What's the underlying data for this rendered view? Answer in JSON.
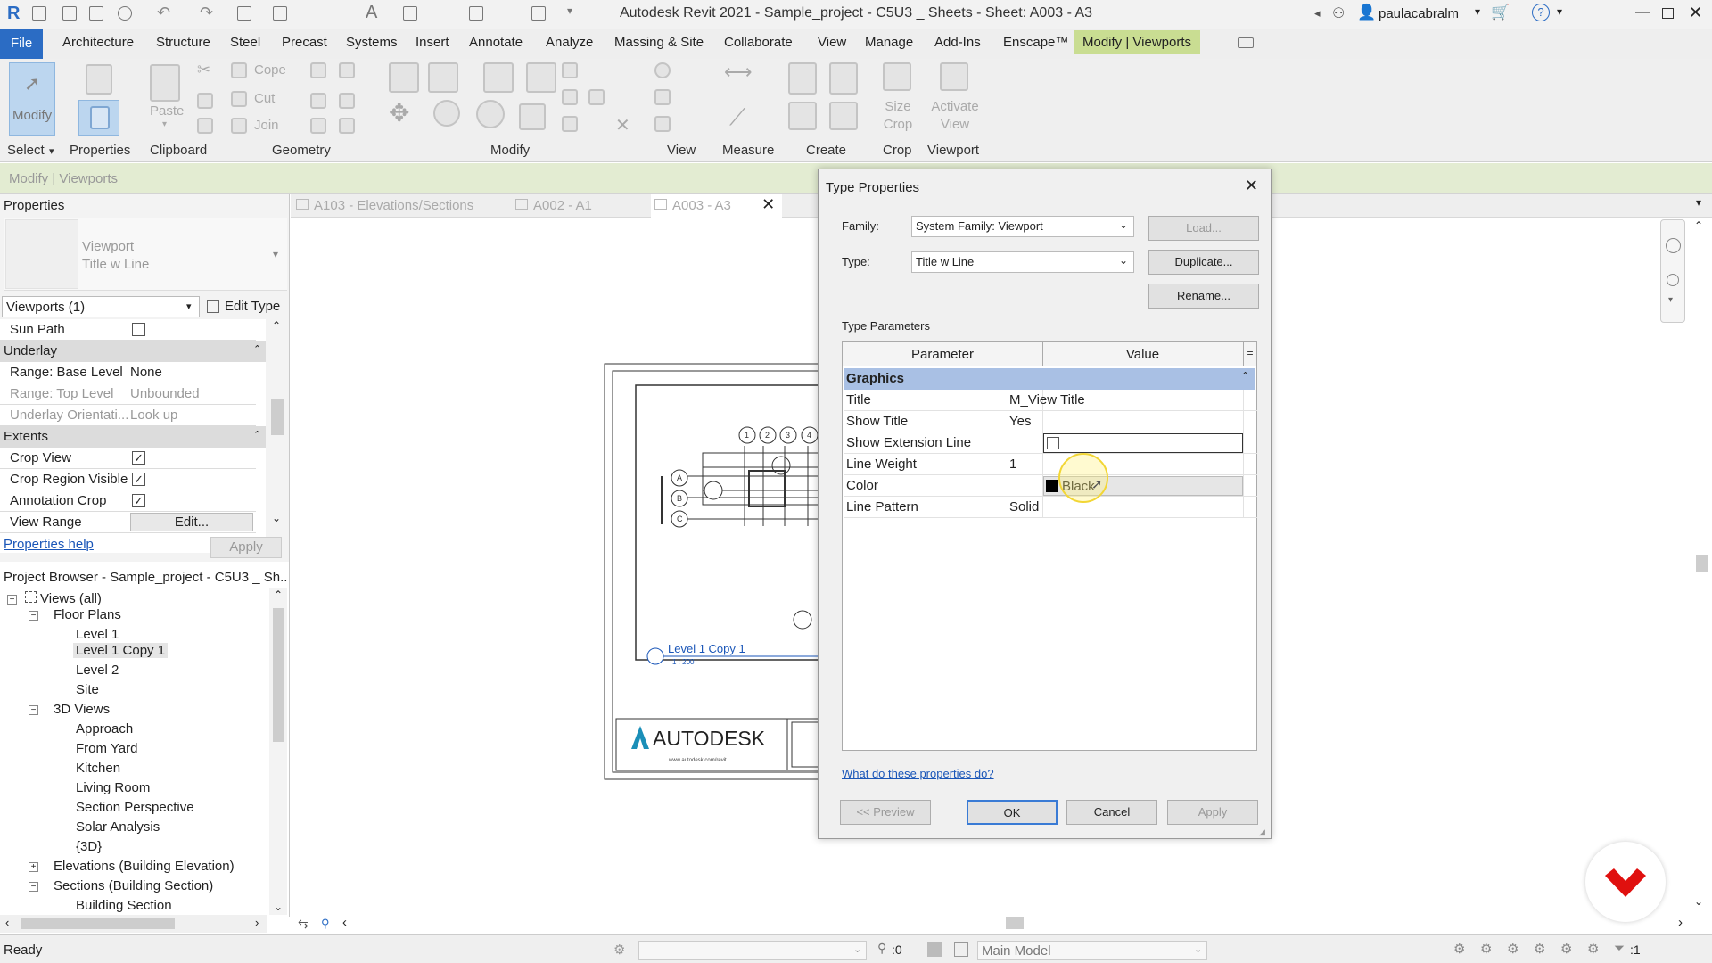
{
  "titlebar": {
    "title": "Autodesk Revit 2021 - Sample_project - C5U3 _ Sheets - Sheet: A003 - A3",
    "user": "paulacabralm"
  },
  "tabs": [
    "File",
    "Architecture",
    "Structure",
    "Steel",
    "Precast",
    "Systems",
    "Insert",
    "Annotate",
    "Analyze",
    "Massing & Site",
    "Collaborate",
    "View",
    "Manage",
    "Add-Ins",
    "Enscape™",
    "Modify | Viewports"
  ],
  "ribbon": {
    "modify": "Modify",
    "paste": "Paste",
    "cope": "Cope",
    "cut": "Cut",
    "join": "Join",
    "size_crop": "Size Crop",
    "activate_view": "Activate View",
    "panels": [
      "Select",
      "Properties",
      "Clipboard",
      "Geometry",
      "Modify",
      "View",
      "Measure",
      "Create",
      "Crop",
      "Viewport"
    ]
  },
  "optbar": {
    "label": "Modify | Viewports"
  },
  "properties": {
    "header": "Properties",
    "type_name": "Viewport",
    "type_sub": "Title w Line",
    "selector": "Viewports (1)",
    "edit_type": "Edit Type",
    "rows": [
      {
        "k": "Sun Path",
        "v": "",
        "check": false
      },
      {
        "group": "Underlay"
      },
      {
        "k": "Range: Base Level",
        "v": "None"
      },
      {
        "k": "Range: Top Level",
        "v": "Unbounded"
      },
      {
        "k": "Underlay Orientati...",
        "v": "Look up"
      },
      {
        "group": "Extents"
      },
      {
        "k": "Crop View",
        "check": true
      },
      {
        "k": "Crop Region Visible",
        "check": true
      },
      {
        "k": "Annotation Crop",
        "check": true
      },
      {
        "k": "View Range",
        "v": "Edit..."
      }
    ],
    "help": "Properties help",
    "apply": "Apply"
  },
  "browser": {
    "header": "Project Browser - Sample_project - C5U3 _ Sh...",
    "items": [
      "Views (all)",
      "Floor Plans",
      "Level 1",
      "Level 1 Copy 1",
      "Level 2",
      "Site",
      "3D Views",
      "Approach",
      "From Yard",
      "Kitchen",
      "Living Room",
      "Section Perspective",
      "Solar Analysis",
      "{3D}",
      "Elevations (Building Elevation)",
      "Sections (Building Section)",
      "Building Section"
    ]
  },
  "doctabs": [
    "A103 - Elevations/Sections",
    "A002 - A1",
    "A003 - A3"
  ],
  "sheet": {
    "view_title": "Level 1 Copy 1",
    "scale": "1 : 200",
    "logo": "AUTODESK",
    "logo_url": "www.autodesk.com/revit",
    "grid_numbers": [
      "1",
      "2",
      "3",
      "4"
    ],
    "grid_letters": [
      "A",
      "B",
      "C"
    ]
  },
  "dialog": {
    "title": "Type Properties",
    "family_label": "Family:",
    "family_value": "System Family: Viewport",
    "type_label": "Type:",
    "type_value": "Title w Line",
    "load": "Load...",
    "duplicate": "Duplicate...",
    "rename": "Rename...",
    "type_params": "Type Parameters",
    "col_param": "Parameter",
    "col_value": "Value",
    "group": "Graphics",
    "rows": [
      {
        "k": "Title",
        "v": "M_View Title"
      },
      {
        "k": "Show Title",
        "v": "Yes"
      },
      {
        "k": "Show Extension Line",
        "v": ""
      },
      {
        "k": "Line Weight",
        "v": "1"
      },
      {
        "k": "Color",
        "v": "Black"
      },
      {
        "k": "Line Pattern",
        "v": "Solid"
      }
    ],
    "help_link": "What do these properties do?",
    "preview": "<< Preview",
    "ok": "OK",
    "cancel": "Cancel",
    "apply": "Apply"
  },
  "status": {
    "text": "Ready",
    "count": ":0",
    "model": "Main Model",
    "filter": ":1"
  },
  "colors": {
    "accent": "#2b6cc4",
    "active_tab": "#c9dd92",
    "graphics_header": "#a9c0e4",
    "link": "#1a56b8",
    "brand_red": "#e0100f"
  }
}
